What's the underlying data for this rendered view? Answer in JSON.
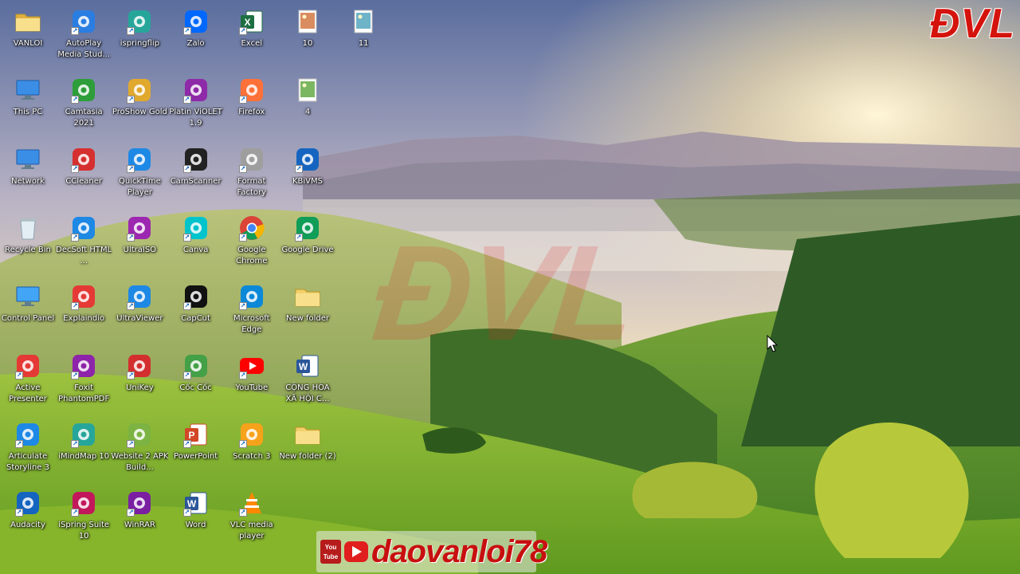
{
  "desktop": {
    "brand_logo": "ĐVL",
    "watermark": "ĐVL",
    "channel": {
      "name": "daovanloi78",
      "badge_icon": "youtube-badge-icon"
    },
    "icons": [
      {
        "label": "VANLOI",
        "icon": "user-folder-icon",
        "color": "#e0b040",
        "col": 0,
        "row": 0
      },
      {
        "label": "AutoPlay Media Stud...",
        "icon": "autoplay-icon",
        "color": "#2a7de1",
        "col": 1,
        "row": 0
      },
      {
        "label": "ispringflip",
        "icon": "ispringflip-icon",
        "color": "#26a69a",
        "col": 2,
        "row": 0
      },
      {
        "label": "Zalo",
        "icon": "zalo-icon",
        "color": "#0068ff",
        "col": 3,
        "row": 0
      },
      {
        "label": "Excel",
        "icon": "excel-icon",
        "color": "#1d6f42",
        "col": 4,
        "row": 0
      },
      {
        "label": "10",
        "icon": "image-file-icon",
        "color": "#d98c5f",
        "col": 5,
        "row": 0
      },
      {
        "label": "11",
        "icon": "image-file-icon",
        "color": "#6fb3c8",
        "col": 6,
        "row": 0
      },
      {
        "label": "This PC",
        "icon": "computer-icon",
        "color": "#3a8ee6",
        "col": 0,
        "row": 1
      },
      {
        "label": "Camtasia 2021",
        "icon": "camtasia-icon",
        "color": "#2e9e3a",
        "col": 1,
        "row": 1
      },
      {
        "label": "ProShow Gold",
        "icon": "proshow-icon",
        "color": "#e0a92e",
        "col": 2,
        "row": 1
      },
      {
        "label": "Platin ViOLET 1.9",
        "icon": "violet-flower-icon",
        "color": "#8e2aa8",
        "col": 3,
        "row": 1
      },
      {
        "label": "Firefox",
        "icon": "firefox-icon",
        "color": "#ff7139",
        "col": 4,
        "row": 1
      },
      {
        "label": "4",
        "icon": "image-file-icon",
        "color": "#7bb661",
        "col": 5,
        "row": 1
      },
      {
        "label": "Network",
        "icon": "network-icon",
        "color": "#3a8ee6",
        "col": 0,
        "row": 2
      },
      {
        "label": "CCleaner",
        "icon": "ccleaner-icon",
        "color": "#d62f2f",
        "col": 1,
        "row": 2
      },
      {
        "label": "QuickTime Player",
        "icon": "quicktime-icon",
        "color": "#1e88e5",
        "col": 2,
        "row": 2
      },
      {
        "label": "CamScanner",
        "icon": "camscanner-icon",
        "color": "#222222",
        "col": 3,
        "row": 2
      },
      {
        "label": "Format Factory",
        "icon": "format-factory-icon",
        "color": "#9e9e9e",
        "col": 4,
        "row": 2
      },
      {
        "label": "KBiVMS",
        "icon": "kbivms-icon",
        "color": "#1565c0",
        "col": 5,
        "row": 2
      },
      {
        "label": "Recycle Bin",
        "icon": "recycle-bin-icon",
        "color": "#cfd8dc",
        "col": 0,
        "row": 3
      },
      {
        "label": "DecSoft HTML ...",
        "icon": "decsoft-icon",
        "color": "#1e88e5",
        "col": 1,
        "row": 3
      },
      {
        "label": "UltraISO",
        "icon": "ultraiso-icon",
        "color": "#9c27b0",
        "col": 2,
        "row": 3
      },
      {
        "label": "Canva",
        "icon": "canva-icon",
        "color": "#00c4cc",
        "col": 3,
        "row": 3
      },
      {
        "label": "Google Chrome",
        "icon": "chrome-icon",
        "color": "#4285f4",
        "col": 4,
        "row": 3
      },
      {
        "label": "Google Drive",
        "icon": "google-drive-icon",
        "color": "#0f9d58",
        "col": 5,
        "row": 3
      },
      {
        "label": "Control Panel",
        "icon": "control-panel-icon",
        "color": "#42a5f5",
        "col": 0,
        "row": 4
      },
      {
        "label": "Explaindio",
        "icon": "explaindio-icon",
        "color": "#e53935",
        "col": 1,
        "row": 4
      },
      {
        "label": "UltraViewer",
        "icon": "ultraviewer-icon",
        "color": "#1e88e5",
        "col": 2,
        "row": 4
      },
      {
        "label": "CapCut",
        "icon": "capcut-icon",
        "color": "#111111",
        "col": 3,
        "row": 4
      },
      {
        "label": "Microsoft Edge",
        "icon": "edge-icon",
        "color": "#0c88d8",
        "col": 4,
        "row": 4
      },
      {
        "label": "New folder",
        "icon": "folder-icon",
        "color": "#f2d06b",
        "col": 5,
        "row": 4
      },
      {
        "label": "Active Presenter",
        "icon": "active-presenter-icon",
        "color": "#e53935",
        "col": 0,
        "row": 5
      },
      {
        "label": "Foxit PhantomPDF",
        "icon": "foxit-icon",
        "color": "#8e24aa",
        "col": 1,
        "row": 5
      },
      {
        "label": "UniKey",
        "icon": "unikey-icon",
        "color": "#d32f2f",
        "col": 2,
        "row": 5
      },
      {
        "label": "Cốc Cốc",
        "icon": "coccoc-icon",
        "color": "#43a047",
        "col": 3,
        "row": 5
      },
      {
        "label": "YouTube",
        "icon": "youtube-icon",
        "color": "#ff0000",
        "col": 4,
        "row": 5
      },
      {
        "label": "CỘNG HÒA XÃ HỘI C...",
        "icon": "word-document-icon",
        "color": "#2b579a",
        "col": 5,
        "row": 5
      },
      {
        "label": "Articulate Storyline 3",
        "icon": "storyline-icon",
        "color": "#1e88e5",
        "col": 0,
        "row": 6
      },
      {
        "label": "iMindMap 10",
        "icon": "imindmap-icon",
        "color": "#26a69a",
        "col": 1,
        "row": 6
      },
      {
        "label": "Website 2 APK Build...",
        "icon": "android-icon",
        "color": "#7cb342",
        "col": 2,
        "row": 6
      },
      {
        "label": "PowerPoint",
        "icon": "powerpoint-icon",
        "color": "#d24726",
        "col": 3,
        "row": 6
      },
      {
        "label": "Scratch 3",
        "icon": "scratch-icon",
        "color": "#f7a21b",
        "col": 4,
        "row": 6
      },
      {
        "label": "New folder (2)",
        "icon": "folder-icon",
        "color": "#f2d06b",
        "col": 5,
        "row": 6
      },
      {
        "label": "Audacity",
        "icon": "audacity-icon",
        "color": "#1565c0",
        "col": 0,
        "row": 7
      },
      {
        "label": "iSpring Suite 10",
        "icon": "ispring-icon",
        "color": "#c2185b",
        "col": 1,
        "row": 7
      },
      {
        "label": "WinRAR",
        "icon": "winrar-icon",
        "color": "#7b1fa2",
        "col": 2,
        "row": 7
      },
      {
        "label": "Word",
        "icon": "word-icon",
        "color": "#2b579a",
        "col": 3,
        "row": 7
      },
      {
        "label": "VLC media player",
        "icon": "vlc-icon",
        "color": "#ff8800",
        "col": 4,
        "row": 7
      }
    ]
  }
}
